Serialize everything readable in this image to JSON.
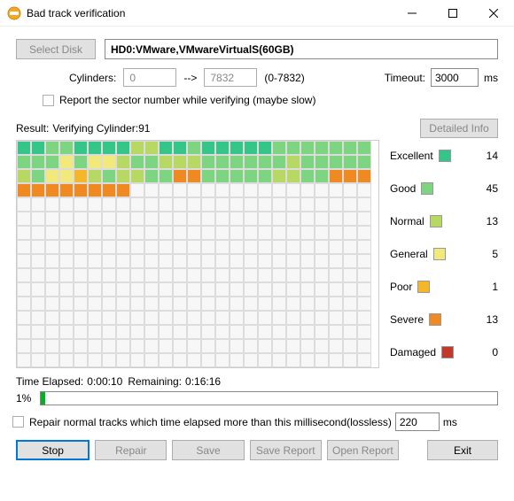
{
  "window": {
    "title": "Bad track verification"
  },
  "top": {
    "select_disk": "Select Disk",
    "disk": "HD0:VMware,VMwareVirtualS(60GB)",
    "cylinders_label": "Cylinders:",
    "cyl_from": "0",
    "arrow": "-->",
    "cyl_to": "7832",
    "cyl_range": "(0-7832)",
    "timeout_label": "Timeout:",
    "timeout_value": "3000",
    "ms": "ms",
    "report_sector": "Report the sector number while verifying (maybe slow)"
  },
  "result": {
    "label": "Result:",
    "status": "Verifying Cylinder:91",
    "detailed": "Detailed Info"
  },
  "legend": {
    "excellent": {
      "label": "Excellent",
      "color": "#35c589",
      "count": "14"
    },
    "good": {
      "label": "Good",
      "color": "#7dd481",
      "count": "45"
    },
    "normal": {
      "label": "Normal",
      "color": "#b7d964",
      "count": "13"
    },
    "general": {
      "label": "General",
      "color": "#f2e97d",
      "count": "5"
    },
    "poor": {
      "label": "Poor",
      "color": "#f5b72a",
      "count": "1"
    },
    "severe": {
      "label": "Severe",
      "color": "#ee8a21",
      "count": "13"
    },
    "damaged": {
      "label": "Damaged",
      "color": "#c0392b",
      "count": "0"
    }
  },
  "grid": {
    "cols": 25,
    "rows": 16,
    "cells": [
      "E",
      "E",
      "G",
      "G",
      "E",
      "E",
      "E",
      "E",
      "N",
      "N",
      "E",
      "E",
      "G",
      "E",
      "E",
      "E",
      "E",
      "E",
      "G",
      "G",
      "G",
      "G",
      "G",
      "G",
      "G",
      "G",
      "G",
      "G",
      "A",
      "G",
      "A",
      "A",
      "N",
      "G",
      "G",
      "N",
      "N",
      "N",
      "G",
      "G",
      "G",
      "G",
      "G",
      "G",
      "N",
      "G",
      "G",
      "G",
      "G",
      "G",
      "N",
      "G",
      "A",
      "A",
      "P",
      "N",
      "G",
      "N",
      "N",
      "G",
      "G",
      "S",
      "S",
      "G",
      "G",
      "G",
      "G",
      "G",
      "N",
      "N",
      "G",
      "G",
      "S",
      "S",
      "S",
      "S",
      "S",
      "S",
      "S",
      "S",
      "S",
      "S",
      "S"
    ]
  },
  "colors": {
    "E": "#35c589",
    "G": "#7dd481",
    "N": "#b7d964",
    "A": "#f2e97d",
    "P": "#f5b72a",
    "S": "#ee8a21",
    "D": "#c0392b"
  },
  "time": {
    "elapsed_label": "Time Elapsed:",
    "elapsed": "0:00:10",
    "remaining_label": "Remaining:",
    "remaining": "0:16:16",
    "percent": "1%",
    "percent_num": 1
  },
  "repair": {
    "label": "Repair normal tracks which time elapsed more than this millisecond(lossless)",
    "value": "220",
    "ms": "ms"
  },
  "buttons": {
    "stop": "Stop",
    "repair": "Repair",
    "save": "Save",
    "save_report": "Save Report",
    "open_report": "Open Report",
    "exit": "Exit"
  }
}
